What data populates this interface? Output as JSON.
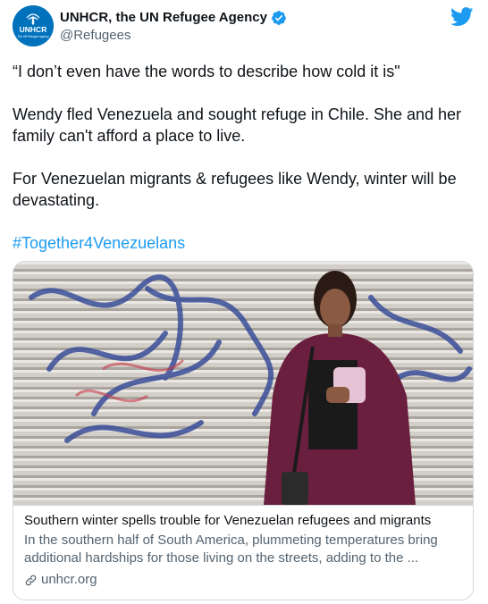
{
  "author": {
    "display_name": "UNHCR, the UN Refugee Agency",
    "handle": "@Refugees",
    "avatar_text": "UNHCR",
    "avatar_subtext": "The UN Refugee Agency",
    "verified_icon": "verified-badge-icon",
    "brand_color": "#0072bc"
  },
  "platform_icon": "twitter-bird-icon",
  "tweet": {
    "paragraph_1": "“I don’t even have the words to describe how cold it is\"",
    "paragraph_2": "Wendy fled Venezuela and sought refuge in Chile. She and her family can't afford a place to live.",
    "paragraph_3": "For Venezuelan migrants & refugees like Wendy, winter will be devastating.",
    "hashtag": "#Together4Venezuelans"
  },
  "card": {
    "title": "Southern winter spells trouble for Venezuelan refugees and migrants",
    "description": "In the southern half of South America, plummeting temperatures bring additional hardships for those living on the streets, adding to the ...",
    "domain": "unhcr.org",
    "link_icon": "link-icon"
  },
  "colors": {
    "link_blue": "#1d9bf0",
    "text_primary": "#0f1419",
    "text_secondary": "#536471",
    "border": "#cfd9de"
  }
}
